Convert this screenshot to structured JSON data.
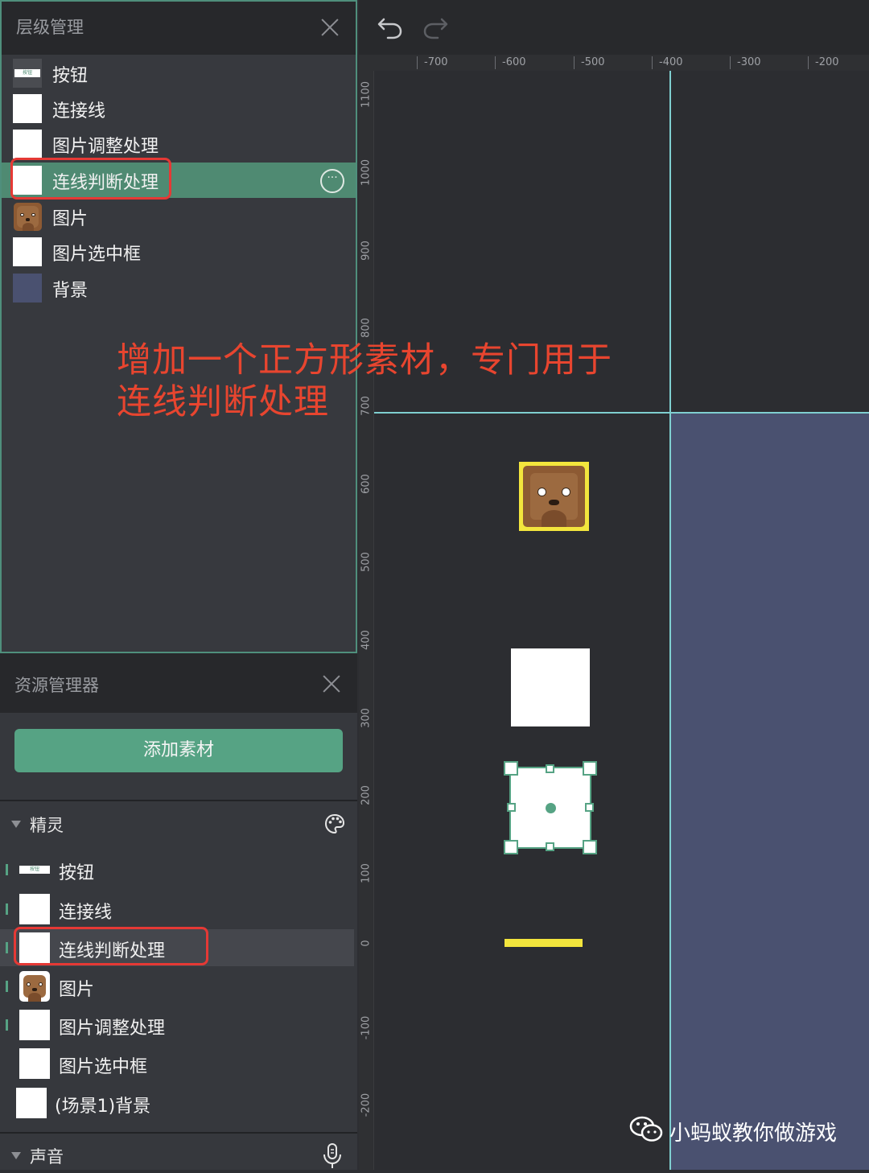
{
  "layer_panel": {
    "title": "层级管理",
    "items": [
      {
        "label": "按钮"
      },
      {
        "label": "连接线"
      },
      {
        "label": "图片调整处理"
      },
      {
        "label": "连线判断处理"
      },
      {
        "label": "图片"
      },
      {
        "label": "图片选中框"
      },
      {
        "label": "背景"
      }
    ],
    "selected_index": 3
  },
  "annotation": {
    "line1": "增加一个正方形素材，专门用于",
    "line2": "连线判断处理",
    "color": "#e8452f"
  },
  "asset_panel": {
    "title": "资源管理器",
    "add_button": "添加素材",
    "sprites_section": "精灵",
    "items": [
      {
        "label": "按钮"
      },
      {
        "label": "连接线"
      },
      {
        "label": "连线判断处理"
      },
      {
        "label": "图片"
      },
      {
        "label": "图片调整处理"
      },
      {
        "label": "图片选中框"
      },
      {
        "label": "(场景1)背景"
      }
    ],
    "sound_section": "声音"
  },
  "button_thumb_text": "按钮",
  "ruler": {
    "top": [
      "-700",
      "-600",
      "-500",
      "-400",
      "-300",
      "-200"
    ],
    "left": [
      "1100",
      "1000",
      "900",
      "800",
      "700",
      "600",
      "500",
      "400",
      "300",
      "200",
      "100",
      "0",
      "-100",
      "-200"
    ]
  },
  "watermark": "小蚂蚁教你做游戏",
  "colors": {
    "accent": "#56a384",
    "highlight_red": "#e53935",
    "guide": "#7fcfd0",
    "scene_bg": "#4a5170",
    "yellow": "#f3e53d"
  }
}
